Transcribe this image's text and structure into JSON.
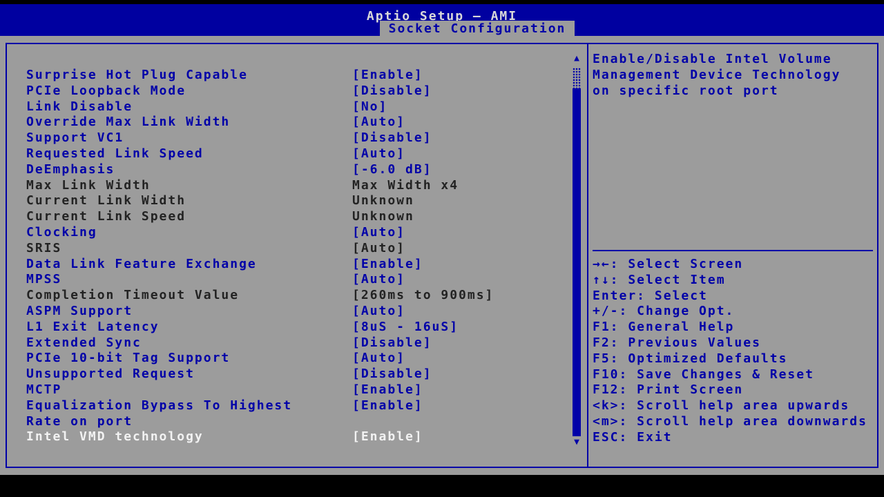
{
  "colors": {
    "accent_blue": "#0000a8",
    "header_blue": "#0000a0",
    "background_gray": "#9c9c9c",
    "disabled_text": "#232323",
    "selected_text": "#f2f2f2",
    "title_text": "#d9d9d9",
    "frame_black": "#000000"
  },
  "header": {
    "title": "Aptio Setup – AMI",
    "tab": "Socket Configuration"
  },
  "menu": {
    "items": [
      {
        "label": "Surprise Hot Plug Capable",
        "value": "[Enable]",
        "state": "active"
      },
      {
        "label": "PCIe Loopback Mode",
        "value": "[Disable]",
        "state": "active"
      },
      {
        "label": "Link Disable",
        "value": "[No]",
        "state": "active"
      },
      {
        "label": "Override Max Link Width",
        "value": "[Auto]",
        "state": "active"
      },
      {
        "label": "Support VC1",
        "value": "[Disable]",
        "state": "active"
      },
      {
        "label": "Requested Link Speed",
        "value": "[Auto]",
        "state": "active"
      },
      {
        "label": "DeEmphasis",
        "value": "[-6.0 dB]",
        "state": "active"
      },
      {
        "label": "Max Link Width",
        "value": "Max Width x4",
        "state": "disabled"
      },
      {
        "label": "Current Link Width",
        "value": "Unknown",
        "state": "disabled"
      },
      {
        "label": "Current Link Speed",
        "value": "Unknown",
        "state": "disabled"
      },
      {
        "label": "Clocking",
        "value": "[Auto]",
        "state": "active"
      },
      {
        "label": "SRIS",
        "value": "[Auto]",
        "state": "disabled"
      },
      {
        "label": "Data Link Feature Exchange",
        "value": "[Enable]",
        "state": "active"
      },
      {
        "label": "MPSS",
        "value": "[Auto]",
        "state": "active"
      },
      {
        "label": "Completion Timeout Value",
        "value": "[260ms to 900ms]",
        "state": "disabled"
      },
      {
        "label": "ASPM Support",
        "value": "[Auto]",
        "state": "active"
      },
      {
        "label": "L1 Exit Latency",
        "value": "[8uS - 16uS]",
        "state": "active"
      },
      {
        "label": "Extended Sync",
        "value": "[Disable]",
        "state": "active"
      },
      {
        "label": "PCIe 10-bit Tag Support",
        "value": "[Auto]",
        "state": "active"
      },
      {
        "label": "Unsupported Request",
        "value": "[Disable]",
        "state": "active"
      },
      {
        "label": "MCTP",
        "value": "[Enable]",
        "state": "active"
      },
      {
        "label": "Equalization Bypass To Highest",
        "value": "[Enable]",
        "state": "active"
      },
      {
        "label": "Rate on port",
        "value": "",
        "state": "active"
      },
      {
        "label": "Intel VMD technology",
        "value": "[Enable]",
        "state": "selected"
      }
    ]
  },
  "scrollbar": {
    "up_icon": "▲",
    "down_icon": "▼"
  },
  "help": {
    "text_lines": [
      "Enable/Disable Intel Volume",
      "Management Device Technology",
      "on specific root port"
    ],
    "key_hints": [
      "→←: Select Screen",
      "↑↓: Select Item",
      "Enter: Select",
      "+/-: Change Opt.",
      "F1: General Help",
      "F2: Previous Values",
      "F5: Optimized Defaults",
      "F10: Save Changes & Reset",
      "F12: Print Screen",
      "<k>: Scroll help area upwards",
      "<m>: Scroll help area downwards",
      "ESC: Exit"
    ]
  }
}
